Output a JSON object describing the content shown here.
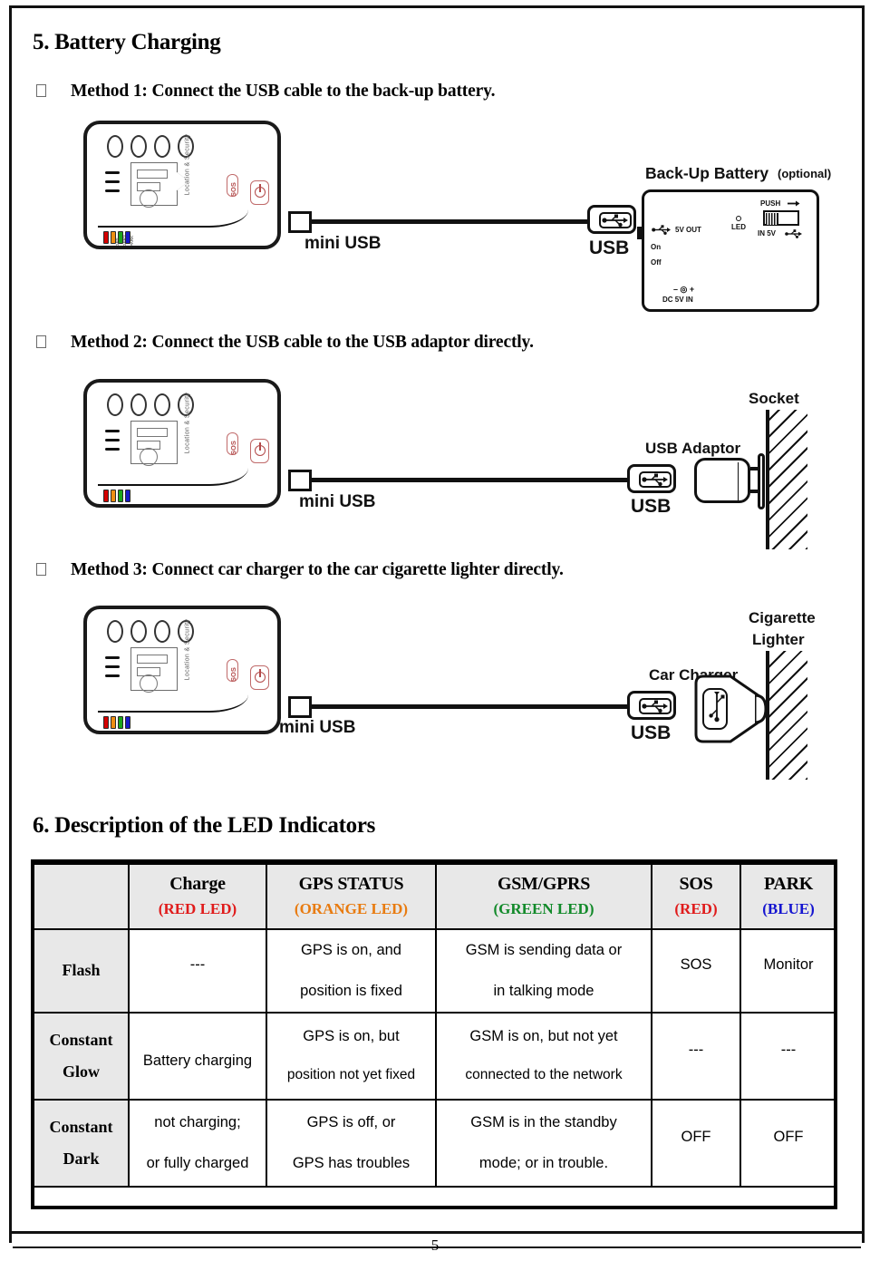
{
  "document": {
    "page_number": "5"
  },
  "sections": [
    {
      "heading": "5. Battery Charging",
      "methods": [
        {
          "text": "Method 1: Connect the USB cable to the back-up battery."
        },
        {
          "text": "Method 2: Connect the USB cable to the USB adaptor directly."
        },
        {
          "text": "Method 3: Connect car charger to the car cigarette lighter directly."
        }
      ]
    },
    {
      "heading": "6. Description of the LED Indicators"
    }
  ],
  "diagram1": {
    "mini_usb_label": "mini USB",
    "usb_label": "USB",
    "backup_battery_title": "Back-Up Battery",
    "backup_battery_optional": "(optional)",
    "labels": {
      "five_v_out": "5V OUT",
      "on": "On",
      "off": "Off",
      "dc_in": "DC 5V   IN",
      "led": "LED",
      "push": "PUSH",
      "in_5v": "IN 5V"
    },
    "device_leds": [
      "POWER",
      "GPS",
      "GPRS",
      "PARK"
    ]
  },
  "diagram2": {
    "mini_usb_label": "mini USB",
    "usb_label": "USB",
    "adaptor_label": "USB Adaptor",
    "socket_label": "Socket"
  },
  "diagram3": {
    "mini_usb_label": "mini USB",
    "usb_label": "USB",
    "charger_label": "Car Charger",
    "lighter_label_line1": "Cigarette",
    "lighter_label_line2": "Lighter"
  },
  "led_table": {
    "columns": [
      {
        "name": "",
        "color_text": "",
        "color_hex": "#000000"
      },
      {
        "name": "Charge",
        "color_text": "(RED LED)",
        "color_hex": "#e01b1b"
      },
      {
        "name": "GPS STATUS",
        "color_text": "(ORANGE LED)",
        "color_hex": "#e87b10"
      },
      {
        "name": "GSM/GPRS",
        "color_text": "(GREEN LED)",
        "color_hex": "#128a2a"
      },
      {
        "name": "SOS",
        "color_text": "(RED)",
        "color_hex": "#e01b1b"
      },
      {
        "name": "PARK",
        "color_text": "(BLUE)",
        "color_hex": "#1414d0"
      }
    ],
    "rows": [
      {
        "mode_line1": "Flash",
        "mode_line2": "",
        "charge_line1": "---",
        "charge_line2": "",
        "gps_line1": "GPS is on, and",
        "gps_line2": "position is fixed",
        "gsm_line1": "GSM is sending data or",
        "gsm_line2": "in talking mode",
        "sos_line1": "SOS",
        "sos_line2": "",
        "park_line1": "Monitor",
        "park_line2": ""
      },
      {
        "mode_line1": "Constant",
        "mode_line2": "Glow",
        "charge_line1": "",
        "charge_line2": "Battery charging",
        "gps_line1": "GPS is on, but",
        "gps_line2": "position not yet fixed",
        "gsm_line1": "GSM is on, but not yet",
        "gsm_line2": "connected to the network",
        "sos_line1": "---",
        "sos_line2": "",
        "park_line1": "---",
        "park_line2": ""
      },
      {
        "mode_line1": "Constant",
        "mode_line2": "Dark",
        "charge_line1": "not charging;",
        "charge_line2": "or fully charged",
        "gps_line1": "GPS is off, or",
        "gps_line2": "GPS has troubles",
        "gsm_line1": "GSM is in the standby",
        "gsm_line2": "mode; or in trouble.",
        "sos_line1": "OFF",
        "sos_line2": "",
        "park_line1": "OFF",
        "park_line2": ""
      }
    ]
  }
}
